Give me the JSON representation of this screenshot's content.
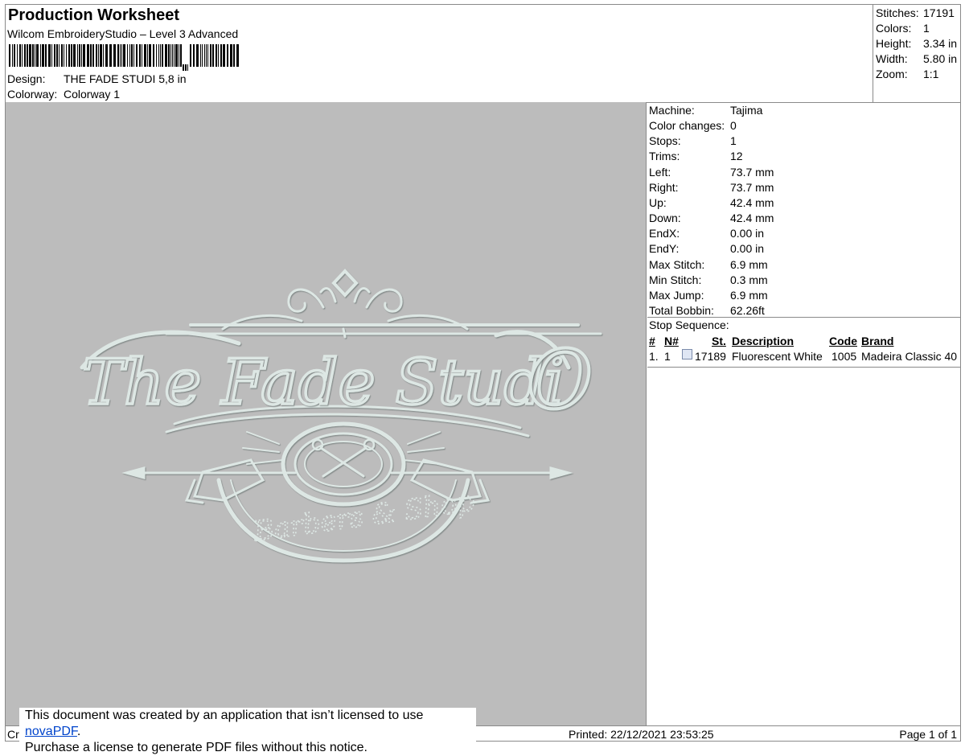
{
  "header": {
    "title": "Production Worksheet",
    "software": "Wilcom EmbroideryStudio – Level 3 Advanced",
    "design_label": "Design:",
    "design_value": "THE FADE STUDI 5,8 in",
    "colorway_label": "Colorway:",
    "colorway_value": "Colorway 1"
  },
  "stats": [
    {
      "label": "Stitches:",
      "value": "17191"
    },
    {
      "label": "Colors:",
      "value": "1"
    },
    {
      "label": "Height:",
      "value": "3.34 in"
    },
    {
      "label": "Width:",
      "value": "5.80 in"
    },
    {
      "label": "Zoom:",
      "value": "1:1"
    }
  ],
  "machine_info": [
    {
      "label": "Machine:",
      "value": "Tajima"
    },
    {
      "label": "Color changes:",
      "value": "0"
    },
    {
      "label": "Stops:",
      "value": "1"
    },
    {
      "label": "Trims:",
      "value": "12"
    },
    {
      "label": "Left:",
      "value": "73.7 mm"
    },
    {
      "label": "Right:",
      "value": "73.7 mm"
    },
    {
      "label": "Up:",
      "value": "42.4 mm"
    },
    {
      "label": "Down:",
      "value": "42.4 mm"
    },
    {
      "label": "EndX:",
      "value": "0.00 in"
    },
    {
      "label": "EndY:",
      "value": "0.00 in"
    },
    {
      "label": "Max Stitch:",
      "value": "6.9 mm"
    },
    {
      "label": "Min Stitch:",
      "value": "0.3 mm"
    },
    {
      "label": "Max Jump:",
      "value": "6.9 mm"
    },
    {
      "label": "Total Bobbin:",
      "value": "62.26ft"
    }
  ],
  "stop_sequence": {
    "title": "Stop Sequence:",
    "headers": {
      "num": "#",
      "needle": "N#",
      "st": "St.",
      "description": "Description",
      "code": "Code",
      "brand": "Brand"
    },
    "rows": [
      {
        "num": "1.",
        "needle": "1",
        "st": "17189",
        "description": "Fluorescent White",
        "code": "1005",
        "brand": "Madeira Classic 40",
        "swatch_color": "#dfe6f4"
      }
    ]
  },
  "design_preview": {
    "text_main": "The Fade Studi",
    "text_tail": "O",
    "text_script": "Barbers & Shop",
    "thread_color": "#dde7e4",
    "background_color": "#bcbcbc"
  },
  "footer": {
    "left": "Cr",
    "printed": "Printed: 22/12/2021 23:53:25",
    "page": "Page 1 of 1"
  },
  "notice": {
    "line1_pre": "This document was created by an application that isn’t licensed to use ",
    "link": "novaPDF",
    "line1_post": ".",
    "line2": "Purchase a license to generate PDF files without this notice."
  }
}
